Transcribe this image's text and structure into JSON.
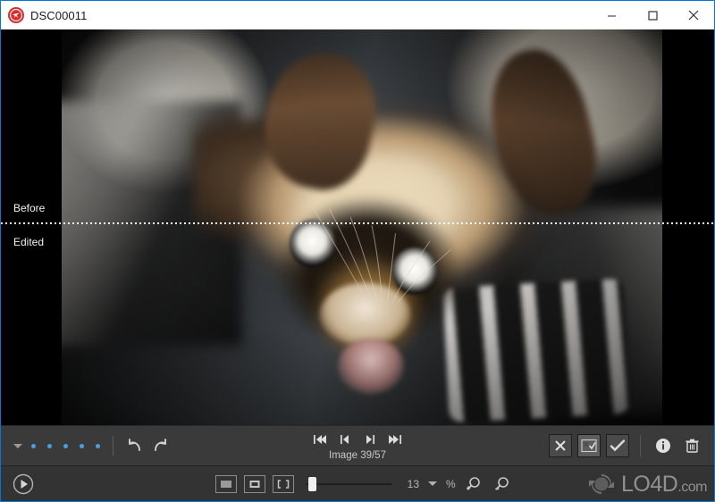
{
  "window": {
    "title": "DSC00011",
    "app_icon": "zoner-bird-icon",
    "controls": {
      "minimize": "minimize-icon",
      "maximize": "maximize-icon",
      "close": "close-icon"
    }
  },
  "viewer": {
    "before_label": "Before",
    "edited_label": "Edited",
    "photo_alt": "Siamese cat lying upside down on a blanket"
  },
  "toolbar": {
    "rating_caret": "chevron-down-icon",
    "rating_dots": 5,
    "rating_color": "#4a9fe0",
    "undo_label": "undo-icon",
    "redo_label": "redo-icon",
    "nav": {
      "first": "first-image-icon",
      "previous": "previous-image-icon",
      "next": "next-image-icon",
      "last": "last-image-icon"
    },
    "image_counter": "Image 39/57",
    "actions": {
      "reject": "reject-x-icon",
      "toggle": "toggle-mixed-icon",
      "accept": "accept-check-icon",
      "info": "info-icon",
      "delete": "trash-icon"
    }
  },
  "statusbar": {
    "play": "play-icon",
    "view_modes": [
      "fit-to-window-icon",
      "actual-size-icon",
      "fullscreen-icon"
    ],
    "zoom_value": "13",
    "zoom_caret": "chevron-down-icon",
    "zoom_unit": "%",
    "zoom_in": "zoom-in-icon",
    "zoom_out": "zoom-out-icon",
    "slider_percent": 5
  },
  "watermark": {
    "text": "LO4D",
    "suffix": ".com",
    "logo": "lo4d-refresh-logo"
  },
  "colors": {
    "accent": "#0078d7",
    "toolbar_bg": "#3a3a3a",
    "statusbar_bg": "#333333",
    "rating_dot": "#4a9fe0",
    "title_bg": "#ffffff",
    "stage_bg": "#000000"
  }
}
